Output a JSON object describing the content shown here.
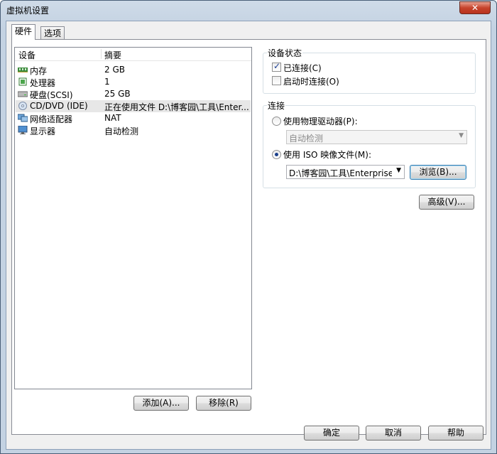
{
  "window": {
    "title": "虚拟机设置",
    "close_glyph": "✕"
  },
  "tabs": [
    {
      "label": "硬件",
      "active": true
    },
    {
      "label": "选项",
      "active": false
    }
  ],
  "device_list": {
    "headers": {
      "device": "设备",
      "summary": "摘要"
    },
    "rows": [
      {
        "device": "内存",
        "summary": "2 GB",
        "icon": "memory-icon"
      },
      {
        "device": "处理器",
        "summary": "1",
        "icon": "processor-icon"
      },
      {
        "device": "硬盘(SCSI)",
        "summary": "25 GB",
        "icon": "hard-disk-icon"
      },
      {
        "device": "CD/DVD (IDE)",
        "summary": "正在使用文件 D:\\博客园\\工具\\Enter...",
        "icon": "cd-dvd-icon",
        "selected": true
      },
      {
        "device": "网络适配器",
        "summary": "NAT",
        "icon": "network-adapter-icon"
      },
      {
        "device": "显示器",
        "summary": "自动检测",
        "icon": "display-icon"
      }
    ]
  },
  "list_buttons": {
    "add": "添加(A)...",
    "remove": "移除(R)"
  },
  "device_status": {
    "title": "设备状态",
    "connected": {
      "label": "已连接(C)",
      "checked": true
    },
    "connect_on_power": {
      "label": "启动时连接(O)",
      "checked": false
    }
  },
  "connection": {
    "title": "连接",
    "physical": {
      "label": "使用物理驱动器(P):",
      "selected": false,
      "combo_value": "自动检测"
    },
    "iso": {
      "label": "使用 ISO 映像文件(M):",
      "selected": true,
      "path": "D:\\博客园\\工具\\Enterprise-R"
    },
    "browse": "浏览(B)...",
    "check_mark": "✓",
    "dropdown_arrow": "▼"
  },
  "advanced_button": "高级(V)...",
  "footer": {
    "ok": "确定",
    "cancel": "取消",
    "help": "帮助"
  }
}
